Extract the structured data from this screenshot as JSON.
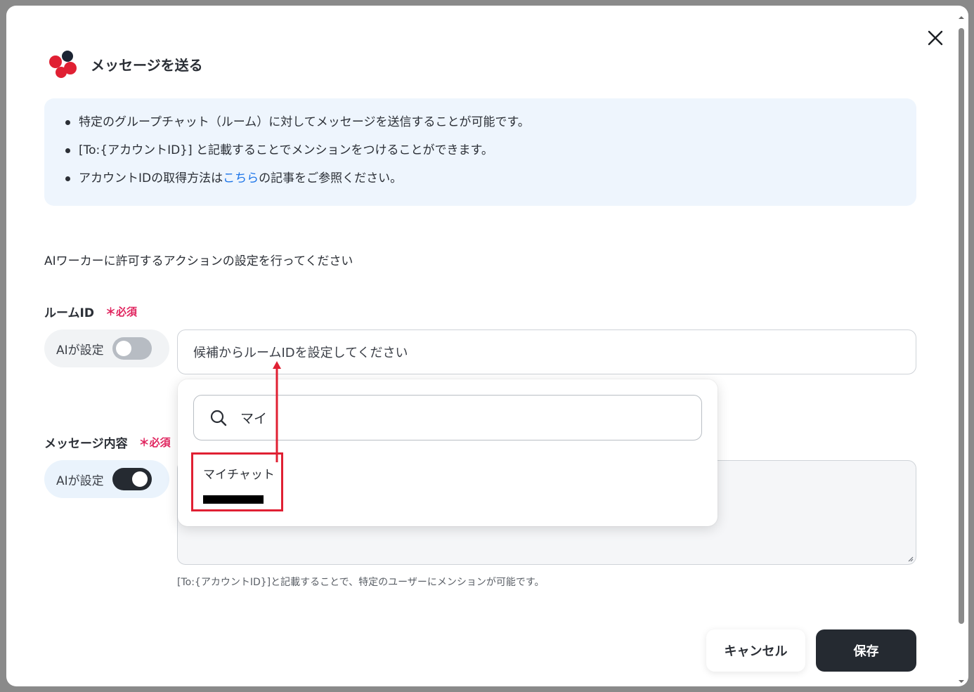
{
  "dialog": {
    "title": "メッセージを送る",
    "close_icon": "close-icon",
    "logo_icon": "chatwork-logo-icon",
    "logo_colors": [
      "#e02033",
      "#1c2433"
    ]
  },
  "info": {
    "items": [
      {
        "text": "特定のグループチャット（ルーム）に対してメッセージを送信することが可能です。"
      },
      {
        "text": "[To:{アカウントID}] と記載することでメンションをつけることができます。"
      },
      {
        "prefix": "アカウントIDの取得方法は",
        "link": "こちら",
        "suffix": "の記事をご参照ください。"
      }
    ]
  },
  "instruction": "AIワーカーに許可するアクションの設定を行ってください",
  "room_field": {
    "label": "ルームID",
    "required": "＊必須",
    "ai_toggle_label": "AIが設定",
    "ai_toggle_on": false,
    "placeholder": "候補からルームIDを設定してください"
  },
  "message_field": {
    "label": "メッセージ内容",
    "required": "＊必須",
    "ai_toggle_label": "AIが設定",
    "ai_toggle_on": true,
    "hint": "[To:{アカウントID}]と記載することで、特定のユーザーにメンションが可能です。"
  },
  "dropdown": {
    "search_value": "マイ",
    "search_icon": "search-icon",
    "options": [
      {
        "label": "マイチャット"
      }
    ]
  },
  "footer": {
    "cancel_label": "キャンセル",
    "save_label": "保存"
  },
  "colors": {
    "accent_dark": "#252a31",
    "required_red": "#e0245e",
    "highlight_red": "#e02033",
    "link_blue": "#1a73e8",
    "info_bg": "#eef5fd"
  }
}
